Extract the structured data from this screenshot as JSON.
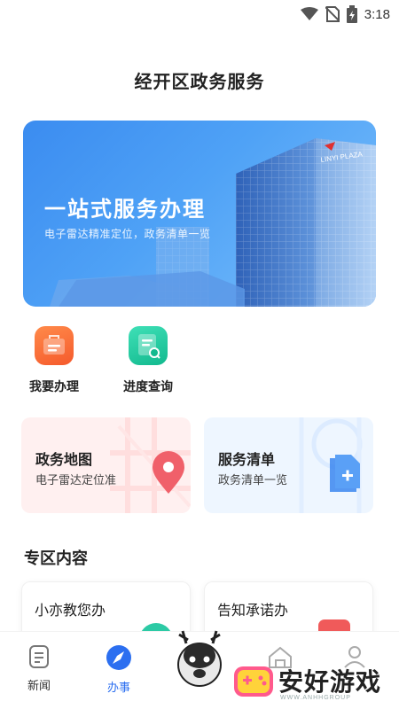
{
  "status_bar": {
    "time": "3:18"
  },
  "page_title": "经开区政务服务",
  "banner": {
    "title": "一站式服务办理",
    "subtitle": "电子雷达精准定位，政务清单一览",
    "building_sign": "LINYI PLAZA"
  },
  "quick_actions": [
    {
      "label": "我要办理",
      "icon": "briefcase-icon"
    },
    {
      "label": "进度查询",
      "icon": "document-search-icon"
    }
  ],
  "cards": [
    {
      "title": "政务地图",
      "subtitle": "电子雷达定位准",
      "icon": "location-pin-icon",
      "color": "#f0606a"
    },
    {
      "title": "服务清单",
      "subtitle": "政务清单一览",
      "icon": "document-plus-icon",
      "color": "#3a86f0"
    }
  ],
  "section": {
    "title": "专区内容"
  },
  "zone_cards": [
    {
      "title": "小亦教您办"
    },
    {
      "title": "告知承诺办"
    }
  ],
  "tabbar": {
    "items": [
      {
        "label": "新闻",
        "icon": "news-icon"
      },
      {
        "label": "办事",
        "icon": "compass-icon",
        "active": true
      },
      {
        "label": "",
        "icon": "home-icon"
      },
      {
        "label": "",
        "icon": "user-icon"
      }
    ]
  },
  "watermark": {
    "text": "安好游戏",
    "url": "WWW.ANHHGROUP"
  },
  "colors": {
    "accent": "#2c6ff0",
    "orange": "#f55a2c",
    "green": "#12b98e"
  }
}
